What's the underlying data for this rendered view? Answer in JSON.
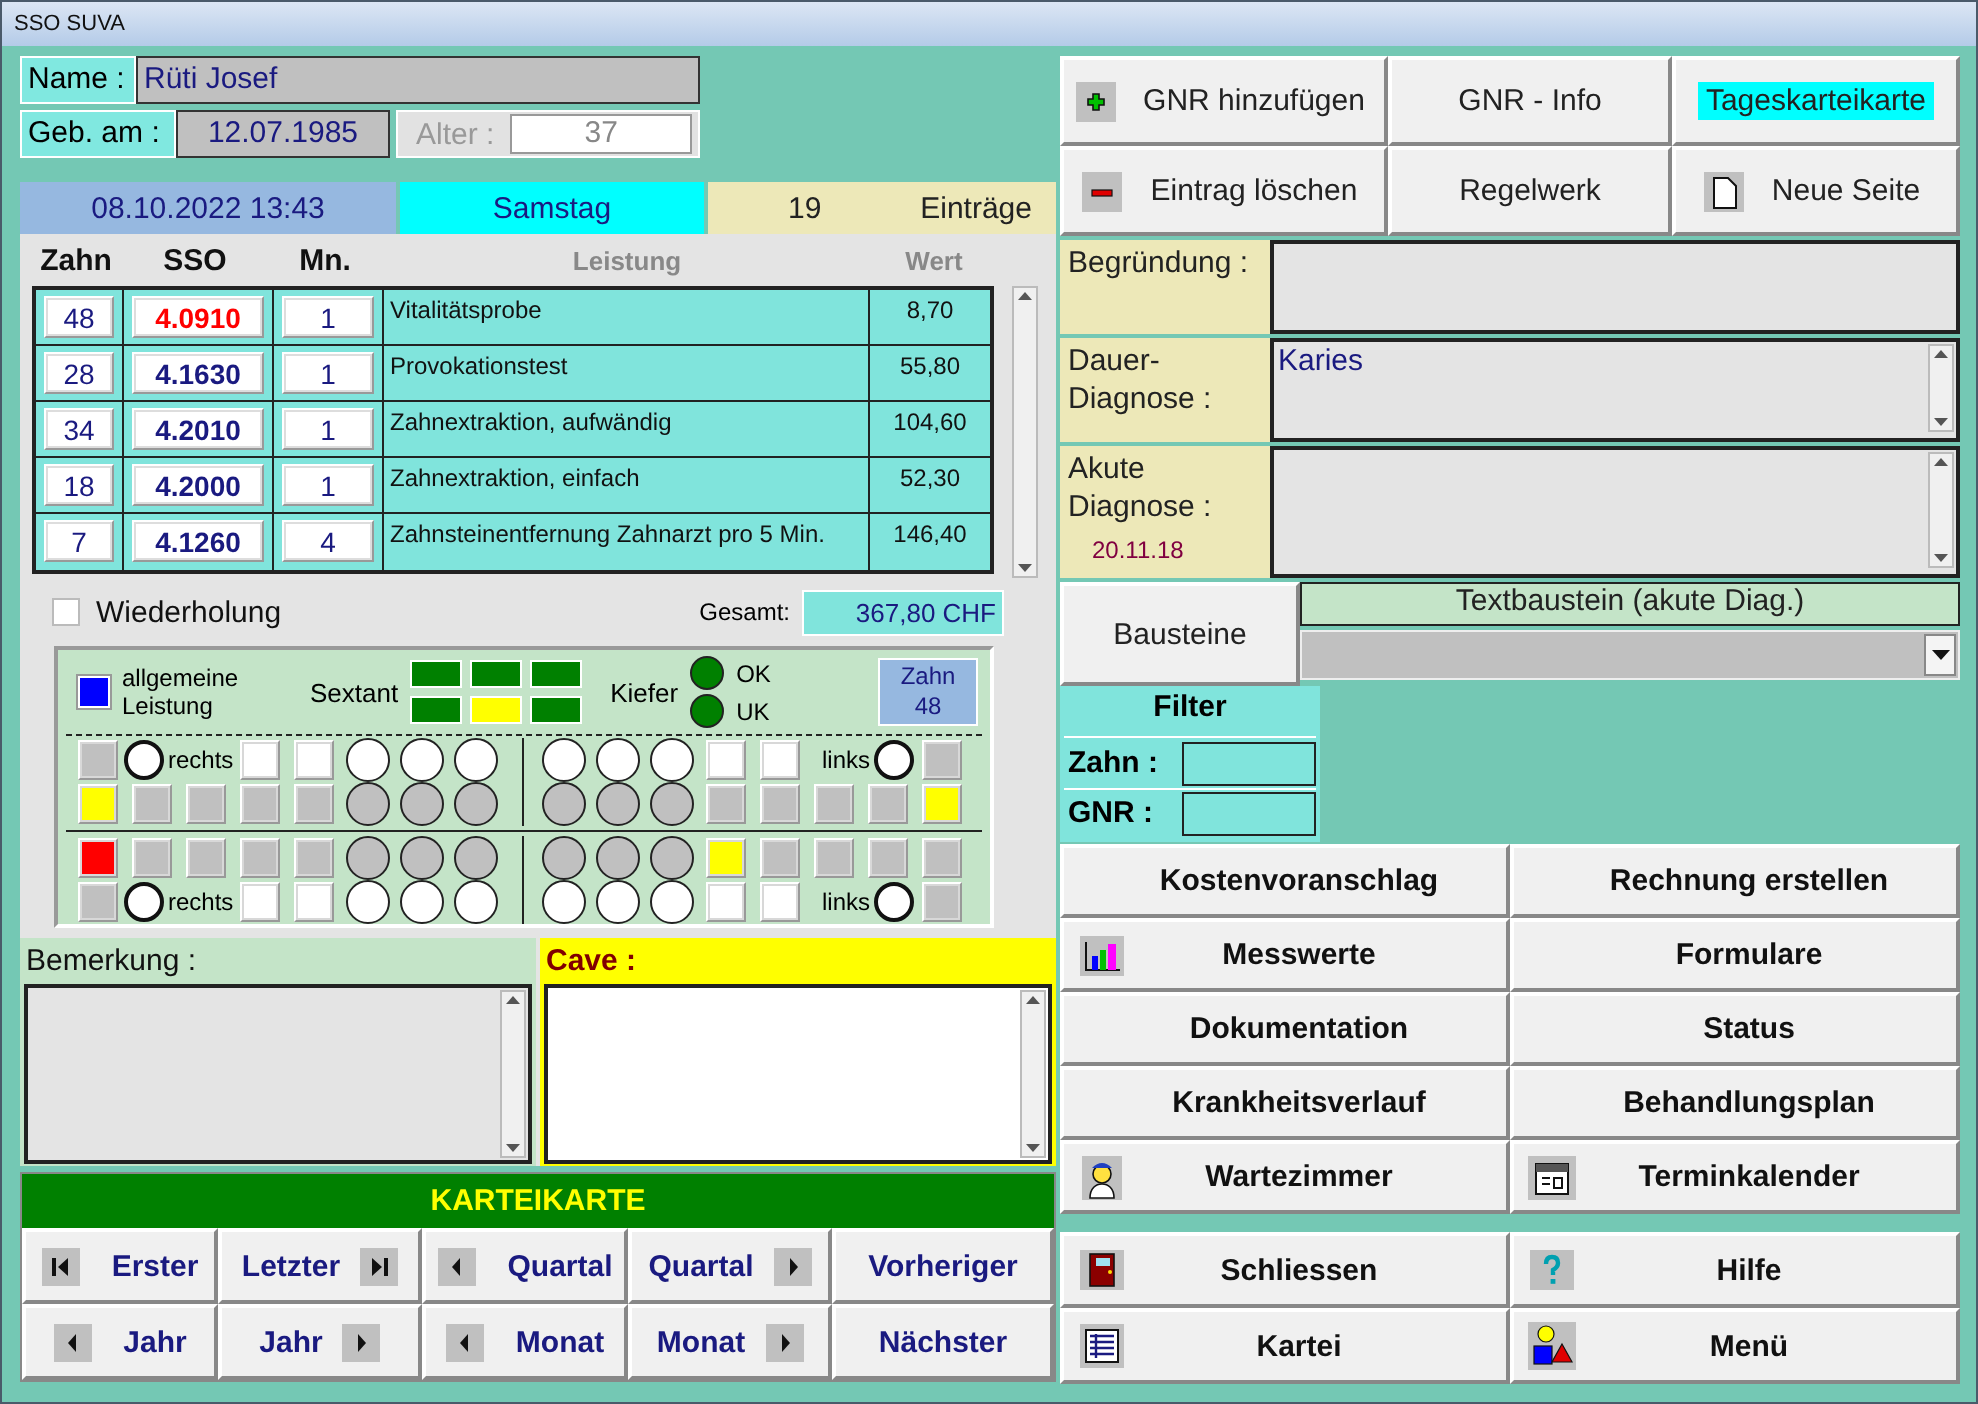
{
  "window": {
    "title": "SSO SUVA"
  },
  "patient": {
    "name_label": "Name :",
    "name": "Rüti Josef",
    "birth_label": "Geb. am :",
    "birth_date": "12.07.1985",
    "age_label": "Alter :",
    "age": "37"
  },
  "date_bar": {
    "datetime": "08.10.2022 13:43",
    "weekday": "Samstag",
    "count": "19",
    "count_label": "Einträge"
  },
  "table": {
    "columns": [
      {
        "label": "Zahn",
        "disabled": false
      },
      {
        "label": "SSO",
        "disabled": false
      },
      {
        "label": "Mn.",
        "disabled": false
      },
      {
        "label": "Leistung",
        "disabled": true
      },
      {
        "label": "Wert",
        "disabled": true
      }
    ],
    "rows": [
      {
        "zahn": "48",
        "sso": "4.0910",
        "mn": "1",
        "leistung": "Vitalitätsprobe",
        "wert": "8,70",
        "selected": true
      },
      {
        "zahn": "28",
        "sso": "4.1630",
        "mn": "1",
        "leistung": "Provokationstest",
        "wert": "55,80",
        "selected": false
      },
      {
        "zahn": "34",
        "sso": "4.2010",
        "mn": "1",
        "leistung": "Zahnextraktion, aufwändig",
        "wert": "104,60",
        "selected": false
      },
      {
        "zahn": "18",
        "sso": "4.2000",
        "mn": "1",
        "leistung": "Zahnextraktion, einfach",
        "wert": "52,30",
        "selected": false
      },
      {
        "zahn": "7",
        "sso": "4.1260",
        "mn": "4",
        "leistung": "Zahnsteinentfernung Zahnarzt pro 5 Min.",
        "wert": "146,40",
        "selected": false
      }
    ]
  },
  "repeat": {
    "label": "Wiederholung",
    "checked": false
  },
  "total": {
    "label": "Gesamt:",
    "value": "367,80 CHF"
  },
  "tooth_chart": {
    "legend": "allgemeine Leistung",
    "sextant_label": "Sextant",
    "sextants": [
      {
        "color": "#008000"
      },
      {
        "color": "#008000"
      },
      {
        "color": "#008000"
      },
      {
        "color": "#008000"
      },
      {
        "color": "#ffff00"
      },
      {
        "color": "#008000"
      }
    ],
    "jaw_label": "Kiefer",
    "jaws": [
      {
        "label": "OK",
        "color": "#008000"
      },
      {
        "label": "UK",
        "color": "#008000"
      }
    ],
    "tooth": {
      "label": "Zahn",
      "value": "48"
    },
    "upper": [
      {
        "left": [
          {
            "kind": "square",
            "color": "#c0c0c0"
          },
          {
            "kind": "ring",
            "label": "rechts"
          },
          {
            "kind": "square",
            "color": "#ffffff"
          },
          {
            "kind": "square",
            "color": "#ffffff"
          },
          {
            "kind": "circle",
            "color": "#ffffff"
          },
          {
            "kind": "circle",
            "color": "#ffffff"
          },
          {
            "kind": "circle",
            "color": "#ffffff"
          }
        ],
        "right": [
          {
            "kind": "circle",
            "color": "#ffffff"
          },
          {
            "kind": "circle",
            "color": "#ffffff"
          },
          {
            "kind": "circle",
            "color": "#ffffff"
          },
          {
            "kind": "square",
            "color": "#ffffff"
          },
          {
            "kind": "square",
            "color": "#ffffff"
          },
          {
            "kind": "ring",
            "label": "links"
          },
          {
            "kind": "square",
            "color": "#c0c0c0"
          }
        ]
      },
      {
        "left": [
          {
            "kind": "square",
            "color": "#ffff00"
          },
          {
            "kind": "square",
            "color": "#c0c0c0"
          },
          {
            "kind": "square",
            "color": "#c0c0c0"
          },
          {
            "kind": "square",
            "color": "#c0c0c0"
          },
          {
            "kind": "square",
            "color": "#c0c0c0"
          },
          {
            "kind": "circle",
            "color": "#c0c0c0"
          },
          {
            "kind": "circle",
            "color": "#c0c0c0"
          },
          {
            "kind": "circle",
            "color": "#c0c0c0"
          }
        ],
        "right": [
          {
            "kind": "circle",
            "color": "#c0c0c0"
          },
          {
            "kind": "circle",
            "color": "#c0c0c0"
          },
          {
            "kind": "circle",
            "color": "#c0c0c0"
          },
          {
            "kind": "square",
            "color": "#c0c0c0"
          },
          {
            "kind": "square",
            "color": "#c0c0c0"
          },
          {
            "kind": "square",
            "color": "#c0c0c0"
          },
          {
            "kind": "square",
            "color": "#c0c0c0"
          },
          {
            "kind": "square",
            "color": "#ffff00"
          }
        ]
      }
    ],
    "lower": [
      {
        "left": [
          {
            "kind": "square",
            "color": "#ff0000"
          },
          {
            "kind": "square",
            "color": "#c0c0c0"
          },
          {
            "kind": "square",
            "color": "#c0c0c0"
          },
          {
            "kind": "square",
            "color": "#c0c0c0"
          },
          {
            "kind": "square",
            "color": "#c0c0c0"
          },
          {
            "kind": "circle",
            "color": "#c0c0c0"
          },
          {
            "kind": "circle",
            "color": "#c0c0c0"
          },
          {
            "kind": "circle",
            "color": "#c0c0c0"
          }
        ],
        "right": [
          {
            "kind": "circle",
            "color": "#c0c0c0"
          },
          {
            "kind": "circle",
            "color": "#c0c0c0"
          },
          {
            "kind": "circle",
            "color": "#c0c0c0"
          },
          {
            "kind": "square",
            "color": "#ffff00"
          },
          {
            "kind": "square",
            "color": "#c0c0c0"
          },
          {
            "kind": "square",
            "color": "#c0c0c0"
          },
          {
            "kind": "square",
            "color": "#c0c0c0"
          },
          {
            "kind": "square",
            "color": "#c0c0c0"
          }
        ]
      },
      {
        "left": [
          {
            "kind": "square",
            "color": "#c0c0c0"
          },
          {
            "kind": "ring",
            "label": "rechts"
          },
          {
            "kind": "square",
            "color": "#ffffff"
          },
          {
            "kind": "square",
            "color": "#ffffff"
          },
          {
            "kind": "circle",
            "color": "#ffffff"
          },
          {
            "kind": "circle",
            "color": "#ffffff"
          },
          {
            "kind": "circle",
            "color": "#ffffff"
          }
        ],
        "right": [
          {
            "kind": "circle",
            "color": "#ffffff"
          },
          {
            "kind": "circle",
            "color": "#ffffff"
          },
          {
            "kind": "circle",
            "color": "#ffffff"
          },
          {
            "kind": "square",
            "color": "#ffffff"
          },
          {
            "kind": "square",
            "color": "#ffffff"
          },
          {
            "kind": "ring",
            "label": "links"
          },
          {
            "kind": "square",
            "color": "#c0c0c0"
          }
        ]
      }
    ]
  },
  "notes": [
    {
      "label": "Bemerkung :",
      "kind": "remark"
    },
    {
      "label": "Cave :",
      "kind": "warning"
    }
  ],
  "record_nav": {
    "title": "KARTEIKARTE",
    "buttons": [
      {
        "label": "Erster",
        "kind": "first"
      },
      {
        "label": "Letzter",
        "kind": "last"
      },
      {
        "label": "Quartal",
        "kind": "prev"
      },
      {
        "label": "Quartal",
        "kind": "next"
      },
      {
        "label": "Vorheriger",
        "kind": "plain"
      },
      {
        "label": "Jahr",
        "kind": "prev"
      },
      {
        "label": "Jahr",
        "kind": "next"
      },
      {
        "label": "Monat",
        "kind": "prev"
      },
      {
        "label": "Monat",
        "kind": "next"
      },
      {
        "label": "Nächster",
        "kind": "plain"
      }
    ]
  },
  "top_buttons": [
    {
      "label": "GNR hinzufügen",
      "kind": "plus",
      "selected": false
    },
    {
      "label": "GNR - Info",
      "kind": "plain",
      "selected": false
    },
    {
      "label": "Tageskarteikarte",
      "kind": "plain",
      "selected": true
    },
    {
      "label": "Eintrag löschen",
      "kind": "minus",
      "selected": false
    },
    {
      "label": "Regelwerk",
      "kind": "plain",
      "selected": false
    },
    {
      "label": "Neue Seite",
      "kind": "page",
      "selected": false
    }
  ],
  "diagnoses": [
    {
      "label": "Begründung :",
      "kind": "plain"
    },
    {
      "label": "Dauer-Diagnose :",
      "value": "Karies",
      "kind": "scrolling"
    },
    {
      "label": "Akute Diagnose :",
      "date": "20.11.18",
      "kind": "scrolling"
    }
  ],
  "bausteine": {
    "button": "Bausteine",
    "header": "Textbaustein (akute Diag.)"
  },
  "filter": {
    "title": "Filter",
    "fields": [
      {
        "label": "Zahn :"
      },
      {
        "label": "GNR :"
      }
    ]
  },
  "actions": [
    {
      "label": "Kostenvoranschlag",
      "kind": "plain"
    },
    {
      "label": "Rechnung erstellen",
      "kind": "plain"
    },
    {
      "label": "Messwerte",
      "kind": "chart"
    },
    {
      "label": "Formulare",
      "kind": "plain"
    },
    {
      "label": "Dokumentation",
      "kind": "plain"
    },
    {
      "label": "Status",
      "kind": "plain"
    },
    {
      "label": "Krankheitsverlauf",
      "kind": "plain"
    },
    {
      "label": "Behandlungsplan",
      "kind": "plain"
    },
    {
      "label": "Wartezimmer",
      "kind": "person"
    },
    {
      "label": "Terminkalender",
      "kind": "calendar"
    }
  ],
  "footer_actions": [
    {
      "label": "Schliessen",
      "kind": "door"
    },
    {
      "label": "Hilfe",
      "kind": "help"
    },
    {
      "label": "Kartei",
      "kind": "list"
    },
    {
      "label": "Menü",
      "kind": "shapes"
    }
  ]
}
